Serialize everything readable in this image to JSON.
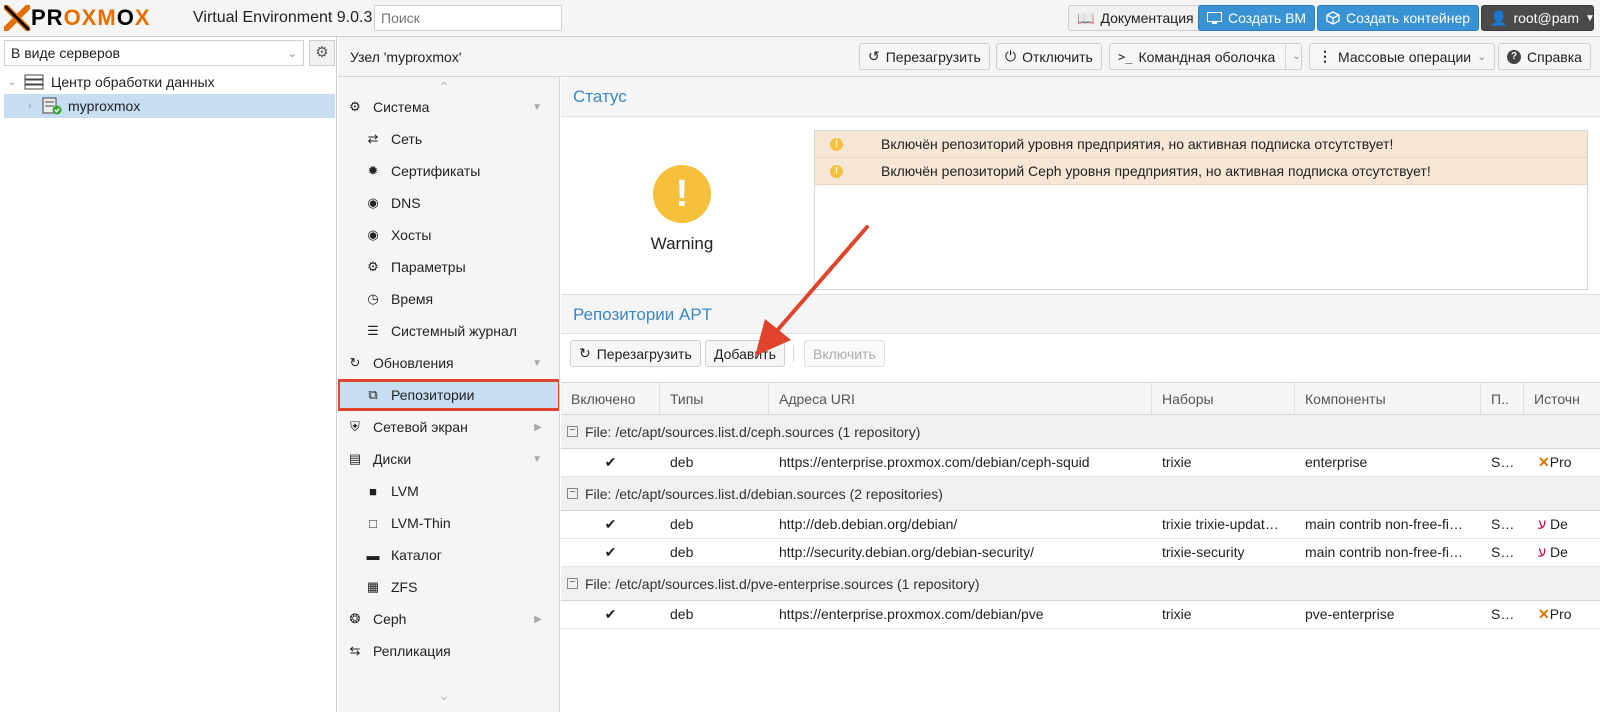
{
  "topbar": {
    "brand": {
      "part1": "PR",
      "part2": "OXM",
      "part3": "O",
      "part4": "X"
    },
    "version": "Virtual Environment 9.0.3",
    "search_placeholder": "Поиск",
    "docs_label": "Документация",
    "create_vm_label": "Создать ВМ",
    "create_ct_label": "Создать контейнер",
    "user_label": "root@pam"
  },
  "left": {
    "view_select": "В виде серверов",
    "tree": [
      {
        "label": "Центр обработки данных"
      },
      {
        "label": "myproxmox"
      }
    ]
  },
  "node": {
    "title": "Узел 'myproxmox'",
    "buttons": {
      "reboot": "Перезагрузить",
      "shutdown": "Отключить",
      "shell": "Командная оболочка",
      "bulk": "Массовые операции",
      "help": "Справка"
    }
  },
  "nav": {
    "items": [
      {
        "label": "Система",
        "icon": "gears-icon"
      },
      {
        "label": "Сеть",
        "icon": "exchange-icon"
      },
      {
        "label": "Сертификаты",
        "icon": "certificate-icon"
      },
      {
        "label": "DNS",
        "icon": "globe-icon"
      },
      {
        "label": "Хосты",
        "icon": "globe-icon"
      },
      {
        "label": "Параметры",
        "icon": "gear-icon"
      },
      {
        "label": "Время",
        "icon": "clock-icon"
      },
      {
        "label": "Системный журнал",
        "icon": "list-icon"
      },
      {
        "label": "Обновления",
        "icon": "refresh-icon"
      },
      {
        "label": "Репозитории",
        "icon": "repo-icon"
      },
      {
        "label": "Сетевой экран",
        "icon": "shield-icon"
      },
      {
        "label": "Диски",
        "icon": "hdd-icon"
      },
      {
        "label": "LVM",
        "icon": "square-icon"
      },
      {
        "label": "LVM-Thin",
        "icon": "square-outline-icon"
      },
      {
        "label": "Каталог",
        "icon": "folder-icon"
      },
      {
        "label": "ZFS",
        "icon": "th-icon"
      },
      {
        "label": "Ceph",
        "icon": "ceph-icon"
      },
      {
        "label": "Репликация",
        "icon": "retweet-icon"
      }
    ]
  },
  "status": {
    "title": "Статус",
    "state": "Warning",
    "messages": [
      "Включён репозиторий уровня предприятия, но активная подписка отсутствует!",
      "Включён репозиторий Ceph уровня предприятия, но активная подписка отсутствует!"
    ]
  },
  "apt": {
    "title": "Репозитории APT",
    "buttons": {
      "reload": "Перезагрузить",
      "add": "Добавить",
      "enable": "Включить"
    },
    "columns": [
      "Включено",
      "Типы",
      "Адреса URI",
      "Наборы",
      "Компоненты",
      "П..",
      "Источн"
    ],
    "groups": [
      {
        "label": "File: /etc/apt/sources.list.d/ceph.sources (1 repository)",
        "rows": [
          {
            "enabled": "✔",
            "type": "deb",
            "uri": "https://enterprise.proxmox.com/debian/ceph-squid",
            "suites": "trixie",
            "components": "enterprise",
            "p": "S…",
            "origin": "Pro"
          }
        ]
      },
      {
        "label": "File: /etc/apt/sources.list.d/debian.sources (2 repositories)",
        "rows": [
          {
            "enabled": "✔",
            "type": "deb",
            "uri": "http://deb.debian.org/debian/",
            "suites": "trixie trixie-updat…",
            "components": "main contrib non-free-fi…",
            "p": "S…",
            "origin": "De"
          },
          {
            "enabled": "✔",
            "type": "deb",
            "uri": "http://security.debian.org/debian-security/",
            "suites": "trixie-security",
            "components": "main contrib non-free-fi…",
            "p": "S…",
            "origin": "De"
          }
        ]
      },
      {
        "label": "File: /etc/apt/sources.list.d/pve-enterprise.sources (1 repository)",
        "rows": [
          {
            "enabled": "✔",
            "type": "deb",
            "uri": "https://enterprise.proxmox.com/debian/pve",
            "suites": "trixie",
            "components": "pve-enterprise",
            "p": "S…",
            "origin": "Pro"
          }
        ]
      }
    ]
  },
  "colors": {
    "accent": "#3c87c7",
    "highlight": "#e0442d",
    "warning": "#f5c03b",
    "brand": "#e57000"
  }
}
